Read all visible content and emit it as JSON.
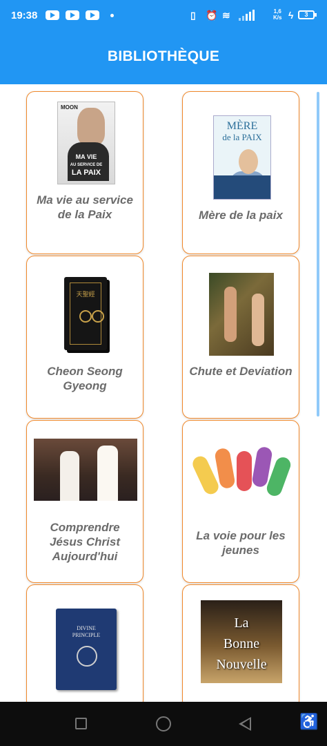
{
  "status_bar": {
    "time": "19:38",
    "network_speed_value": "1,6",
    "network_speed_unit": "K/s",
    "battery": "3",
    "icons": [
      "youtube-icon",
      "youtube-icon",
      "youtube-icon",
      "notification-dot",
      "vibrate-icon",
      "alarm-icon",
      "wifi-icon",
      "signal-icon",
      "charging-icon",
      "battery-icon"
    ]
  },
  "header": {
    "title": "BIBLIOTHÈQUE",
    "color": "#2196f3"
  },
  "books": [
    {
      "label": "Ma vie au service de la Paix",
      "cover_text_top": "MOON",
      "cover_text_1": "MA VIE",
      "cover_text_2": "AU SERVICE DE",
      "cover_text_3": "LA PAIX"
    },
    {
      "label": "Mère de la paix",
      "cover_text_1": "MÈRE",
      "cover_text_2": "de la PAIX"
    },
    {
      "label": "Cheon Seong Gyeong",
      "cover_text_1": "天聖經"
    },
    {
      "label": "Chute et Deviation"
    },
    {
      "label": "Comprendre Jésus Christ Aujourd'hui"
    },
    {
      "label": "La voie pour les jeunes"
    },
    {
      "label": "",
      "cover_text_1": "DIVINE",
      "cover_text_2": "PRINCIPLE"
    },
    {
      "label": "",
      "cover_text_1": "La",
      "cover_text_2": "Bonne",
      "cover_text_3": "Nouvelle"
    }
  ],
  "accent_color": "#f0882a",
  "nav_bar": {
    "icons": [
      "recents-icon",
      "home-icon",
      "back-icon",
      "accessibility-icon"
    ]
  }
}
